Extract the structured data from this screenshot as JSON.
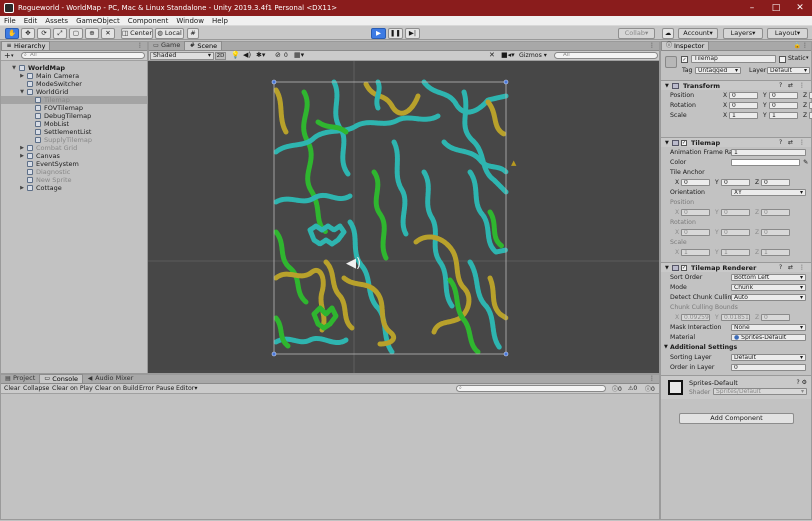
{
  "window": {
    "title": "Rogueworld - WorldMap - PC, Mac & Linux Standalone - Unity 2019.3.4f1 Personal <DX11>",
    "min": "–",
    "max": "□",
    "close": "✕"
  },
  "menu": [
    "File",
    "Edit",
    "Assets",
    "GameObject",
    "Component",
    "Window",
    "Help"
  ],
  "toolbar": {
    "pivot": "Center",
    "space": "Local",
    "collab": "Collab",
    "account": "Account",
    "layers": "Layers",
    "layout": "Layout"
  },
  "hierarchy": {
    "tab": "Hierarchy",
    "add": "+",
    "search_placeholder": "All",
    "rows": [
      {
        "label": "WorldMap",
        "depth": 0,
        "arrow": "▼",
        "root": true
      },
      {
        "label": "Main Camera",
        "depth": 1,
        "arrow": "▶"
      },
      {
        "label": "ModeSwitcher",
        "depth": 1,
        "arrow": ""
      },
      {
        "label": "WorldGrid",
        "depth": 1,
        "arrow": "▼"
      },
      {
        "label": "Tilemap",
        "depth": 2,
        "arrow": "",
        "selected": true,
        "dim": true
      },
      {
        "label": "FOVTilemap",
        "depth": 2,
        "arrow": ""
      },
      {
        "label": "DebugTilemap",
        "depth": 2,
        "arrow": ""
      },
      {
        "label": "MobList",
        "depth": 2,
        "arrow": ""
      },
      {
        "label": "SettlementList",
        "depth": 2,
        "arrow": ""
      },
      {
        "label": "SupplyTilemap",
        "depth": 2,
        "arrow": "",
        "dim": true
      },
      {
        "label": "Combat Grid",
        "depth": 1,
        "arrow": "▶",
        "dim": true
      },
      {
        "label": "Canvas",
        "depth": 1,
        "arrow": "▶"
      },
      {
        "label": "EventSystem",
        "depth": 1,
        "arrow": ""
      },
      {
        "label": "Diagnostic",
        "depth": 1,
        "arrow": "",
        "dim": true
      },
      {
        "label": "New Sprite",
        "depth": 1,
        "arrow": "",
        "dim": true
      },
      {
        "label": "Cottage",
        "depth": 1,
        "arrow": "▶"
      }
    ]
  },
  "scene": {
    "tabs": [
      "Game",
      "Scene"
    ],
    "shading": "Shaded",
    "mode2d": "2D",
    "hidden_count": "0",
    "gizmos": "Gizmos",
    "search_placeholder": "All",
    "colors": {
      "background": "#474747",
      "teal": "#2eb5b0",
      "green": "#2fb62f",
      "gold": "#b8a12b"
    }
  },
  "bottom": {
    "tabs": [
      "Project",
      "Console",
      "Audio Mixer"
    ],
    "buttons": [
      "Clear",
      "Collapse",
      "Clear on Play",
      "Clear on Build",
      "Error Pause",
      "Editor"
    ],
    "counts": {
      "info": "0",
      "warn": "0",
      "error": "0"
    }
  },
  "inspector": {
    "tab": "Inspector",
    "object_name": "Tilemap",
    "static_label": "Static",
    "tag_label": "Tag",
    "tag": "Untagged",
    "layer_label": "Layer",
    "layer": "Default",
    "transform": {
      "title": "Transform",
      "position_label": "Position",
      "rotation_label": "Rotation",
      "scale_label": "Scale",
      "position": [
        "0",
        "0",
        "0"
      ],
      "rotation": [
        "0",
        "0",
        "0"
      ],
      "scale": [
        "1",
        "1",
        "1"
      ]
    },
    "tilemap": {
      "title": "Tilemap",
      "frame_rate_label": "Animation Frame Rate",
      "frame_rate": "1",
      "color_label": "Color",
      "tile_anchor_label": "Tile Anchor",
      "tile_anchor": [
        "0",
        "0",
        "0"
      ],
      "orientation_label": "Orientation",
      "orientation": "XY",
      "position_label": "Position",
      "position": [
        "0",
        "0",
        "0"
      ],
      "rotation_label": "Rotation",
      "rotation": [
        "0",
        "0",
        "0"
      ],
      "scale_label": "Scale",
      "scale": [
        "1",
        "1",
        "1"
      ]
    },
    "renderer": {
      "title": "Tilemap Renderer",
      "sort_order_label": "Sort Order",
      "sort_order": "Bottom Left",
      "mode_label": "Mode",
      "mode": "Chunk",
      "detect_label": "Detect Chunk Culling",
      "detect": "Auto",
      "bounds_label": "Chunk Culling Bounds",
      "bounds": [
        "0.0925926",
        "0.01851851",
        "0"
      ],
      "mask_label": "Mask Interaction",
      "mask": "None",
      "material_label": "Material",
      "material": "Sprites-Default",
      "additional_label": "Additional Settings",
      "sorting_layer_label": "Sorting Layer",
      "sorting_layer": "Default",
      "order_label": "Order in Layer",
      "order": "0"
    },
    "material_block": {
      "name": "Sprites-Default",
      "shader_label": "Shader",
      "shader": "Sprites/Default"
    },
    "add_component": "Add Component"
  }
}
